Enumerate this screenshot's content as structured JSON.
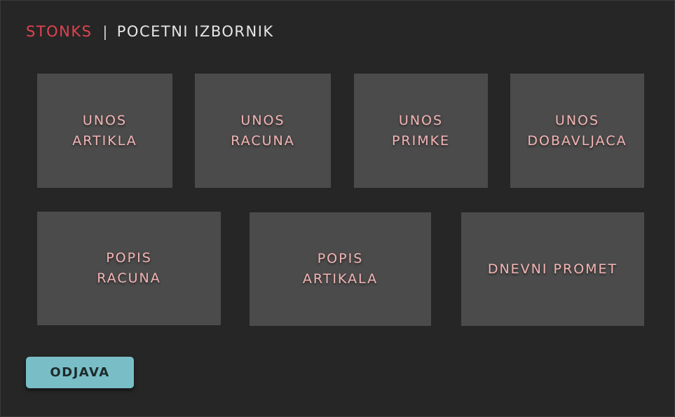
{
  "header": {
    "brand": "STONKS",
    "separator": "|",
    "title": "POCETNI IZBORNIK"
  },
  "tiles": [
    {
      "label": "UNOS\nARTIKLA"
    },
    {
      "label": "UNOS\nRACUNA"
    },
    {
      "label": "UNOS\nPRIMKE"
    },
    {
      "label": "UNOS\nDOBAVLJACA"
    },
    {
      "label": "POPIS\nRACUNA"
    },
    {
      "label": "POPIS\nARTIKALA"
    },
    {
      "label": "DNEVNI PROMET"
    }
  ],
  "footer": {
    "logout_label": "ODJAVA"
  },
  "colors": {
    "background": "#262626",
    "tile": "#4b4b4b",
    "tile_text": "#f4b4b4",
    "brand": "#e0434f",
    "logout_button": "#79bec6"
  }
}
